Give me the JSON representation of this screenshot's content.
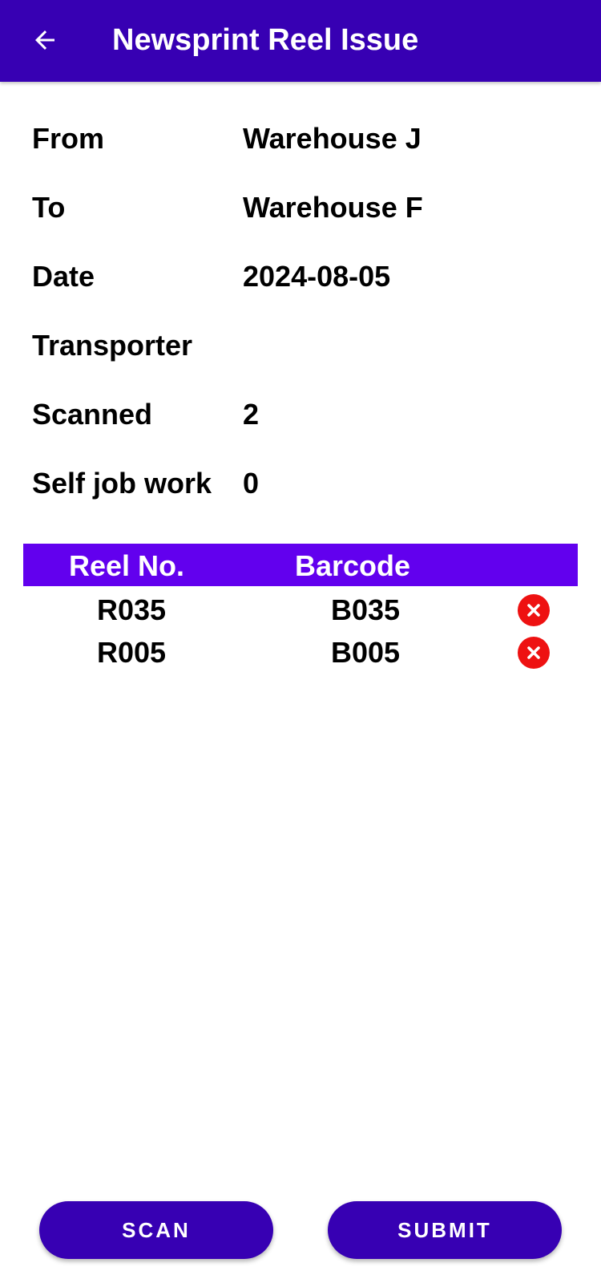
{
  "app_bar": {
    "title": "Newsprint Reel Issue",
    "back_icon": "arrow-left-icon",
    "color": "#3700b3"
  },
  "details": [
    {
      "label": "From",
      "value": "Warehouse J"
    },
    {
      "label": "To",
      "value": "Warehouse F"
    },
    {
      "label": "Date",
      "value": "2024-08-05"
    },
    {
      "label": "Transporter",
      "value": ""
    },
    {
      "label": "Scanned",
      "value": "2"
    },
    {
      "label": "Self job work",
      "value": "0"
    }
  ],
  "table": {
    "header_color": "#6200ee",
    "columns": [
      "Reel No.",
      "Barcode"
    ],
    "rows": [
      {
        "reel_no": "R035",
        "barcode": "B035",
        "remove_icon": "close-circle-icon"
      },
      {
        "reel_no": "R005",
        "barcode": "B005",
        "remove_icon": "close-circle-icon"
      }
    ]
  },
  "actions": {
    "scan_label": "SCAN",
    "submit_label": "SUBMIT"
  }
}
